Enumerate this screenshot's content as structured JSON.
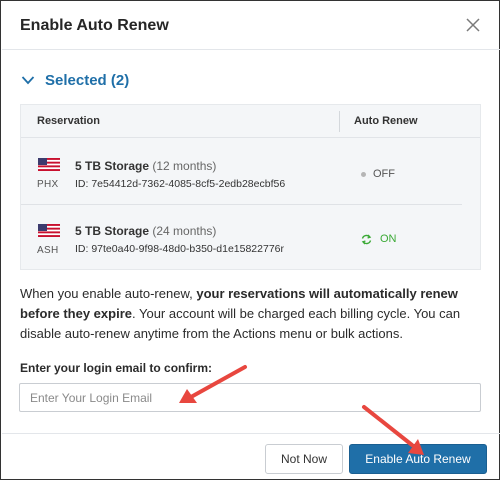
{
  "modal": {
    "title": "Enable Auto Renew",
    "close_icon": "close-icon"
  },
  "selected": {
    "label": "Selected (2)"
  },
  "table": {
    "headers": {
      "reservation": "Reservation",
      "auto_renew": "Auto Renew"
    },
    "rows": [
      {
        "location": "PHX",
        "name": "5 TB Storage",
        "duration": "(12 months)",
        "id": "ID: 7e54412d-7362-4085-8cf5-2edb28ecbf56",
        "status": "OFF"
      },
      {
        "location": "ASH",
        "name": "5 TB Storage",
        "duration": "(24 months)",
        "id": "ID: 97te0a40-9f98-48d0-b350-d1e15822776r",
        "status": "ON"
      }
    ]
  },
  "info": {
    "part1": "When you enable auto-renew, ",
    "bold": "your reservations will automatically renew before they expire",
    "part2": ". Your account will be charged each billing cycle. You can disable auto-renew anytime from the Actions menu or bulk actions."
  },
  "confirm": {
    "label": "Enter your login email to confirm:",
    "placeholder": "Enter Your Login Email",
    "value": ""
  },
  "footer": {
    "cancel_label": "Not Now",
    "submit_label": "Enable Auto Renew"
  },
  "colors": {
    "accent": "#1f6fa8",
    "on": "#3aa935",
    "annotation_arrow": "#e8473f"
  }
}
